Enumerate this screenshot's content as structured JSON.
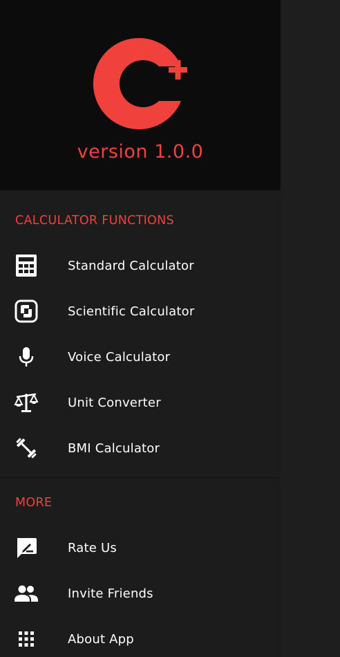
{
  "header": {
    "logo_name": "C+ logo",
    "version": "version 1.0.0",
    "accent_color": "#f0413c"
  },
  "sections": {
    "calculator_functions": {
      "title": "CALCULATOR FUNCTIONS",
      "items": [
        {
          "label": "Standard Calculator",
          "icon": "calculator-icon"
        },
        {
          "label": "Scientific Calculator",
          "icon": "scientific-icon"
        },
        {
          "label": "Voice Calculator",
          "icon": "microphone-icon"
        },
        {
          "label": "Unit Converter",
          "icon": "scale-icon"
        },
        {
          "label": "BMI Calculator",
          "icon": "dumbbell-icon"
        }
      ]
    },
    "more": {
      "title": "MORE",
      "items": [
        {
          "label": "Rate Us",
          "icon": "rate-review-icon"
        },
        {
          "label": "Invite Friends",
          "icon": "people-icon"
        },
        {
          "label": "About App",
          "icon": "apps-grid-icon"
        }
      ]
    }
  }
}
